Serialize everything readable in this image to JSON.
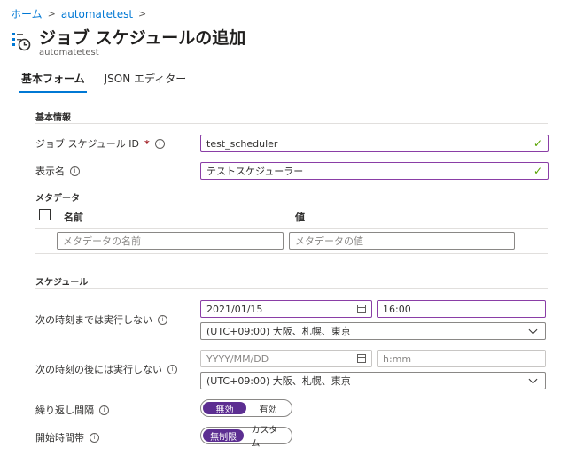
{
  "breadcrumb": {
    "home": "ホーム",
    "account": "automatetest"
  },
  "header": {
    "title": "ジョブ スケジュールの追加",
    "subtitle": "automatetest"
  },
  "tabs": [
    {
      "label": "基本フォーム"
    },
    {
      "label": "JSON エディター"
    }
  ],
  "basic": {
    "section": "基本情報",
    "id_label": "ジョブ スケジュール ID",
    "id_value": "test_scheduler",
    "name_label": "表示名",
    "name_value": "テストスケジューラー"
  },
  "metadata": {
    "section": "メタデータ",
    "col_name": "名前",
    "col_value": "値",
    "name_placeholder": "メタデータの名前",
    "value_placeholder": "メタデータの値"
  },
  "schedule": {
    "section": "スケジュール",
    "not_before_label": "次の時刻までは実行しない",
    "not_before_date": "2021/01/15",
    "not_before_time": "16:00",
    "not_before_tz": "(UTC+09:00) 大阪、札幌、東京",
    "not_after_label": "次の時刻の後には実行しない",
    "not_after_date_placeholder": "YYYY/MM/DD",
    "not_after_time_placeholder": "h:mm",
    "not_after_tz": "(UTC+09:00) 大阪、札幌、東京",
    "recurrence_label": "繰り返し間隔",
    "recurrence_off": "無効",
    "recurrence_on": "有効",
    "window_label": "開始時間帯",
    "window_unlimited": "無制限",
    "window_custom": "カスタム"
  },
  "colors": {
    "accent": "#0078d4",
    "toggle_selected": "#5c2e91",
    "focus_border": "#8a3ea6",
    "valid_check": "#57a300"
  }
}
